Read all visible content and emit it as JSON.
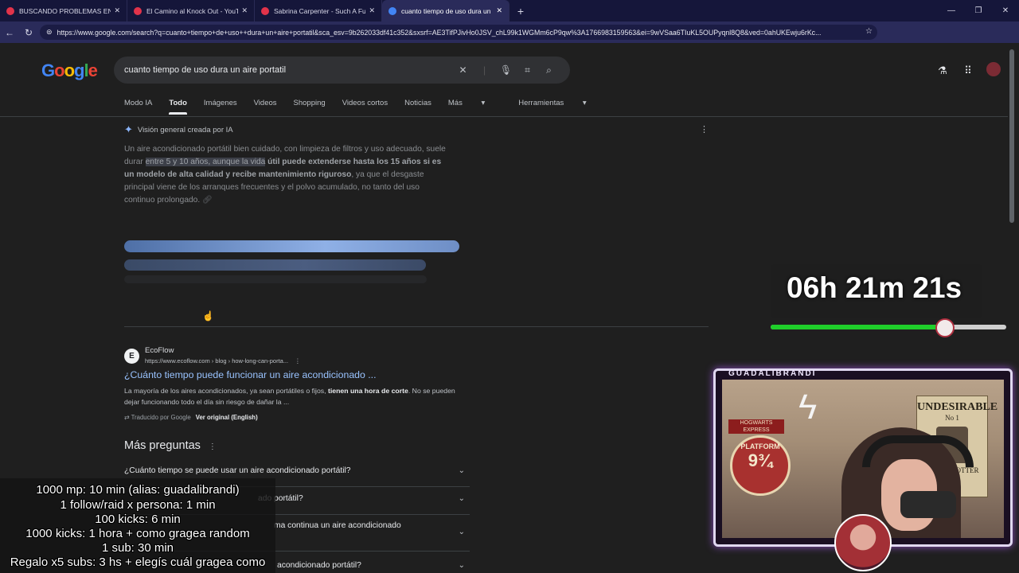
{
  "browser": {
    "tabs": [
      {
        "title": "BUSCANDO PROBLEMAS EN FLOR",
        "color": "#e2334a"
      },
      {
        "title": "El Camino al Knock Out - YouTube",
        "color": "#e2334a"
      },
      {
        "title": "Sabrina Carpenter - Such A Fu",
        "color": "#e2334a"
      },
      {
        "title": "cuanto tiempo de uso dura un aire",
        "color": "#4285f4"
      }
    ],
    "new_tab": "+",
    "url": "https://www.google.com/search?q=cuanto+tiempo+de+uso++dura+un+aire+portatil&sca_esv=9b262033df41c352&sxsrf=AE3TifPJivHo0JSV_chL99k1WGMm6cP9qw%3A1766983159563&ei=9wVSaa6TIuKL5OUPyqnl8Q8&ved=0ahUKEwju6rKc..."
  },
  "search": {
    "logo": "Google",
    "query": "cuanto tiempo de uso dura un aire portatil",
    "tabs": [
      "Modo IA",
      "Todo",
      "Imágenes",
      "Videos",
      "Shopping",
      "Videos cortos",
      "Noticias",
      "Más",
      "Herramientas"
    ]
  },
  "ai_overview": {
    "header": "Visión general creada por IA",
    "text_1": "Un aire acondicionado portátil bien cuidado, con limpieza de filtros y uso adecuado, suele durar ",
    "text_highlight": "entre 5 y 10 años, aunque la vida",
    "text_2": " útil puede extenderse hasta los 15 años si es un modelo de alta calidad y recibe mantenimiento riguroso",
    "text_3": ", ya que el desgaste principal viene de los arranques frecuentes y el polvo acumulado, no tanto del uso continuo prolongado."
  },
  "result": {
    "site": "EcoFlow",
    "url": "https://www.ecoflow.com › blog › how-long-can-porta...",
    "title": "¿Cuánto tiempo puede funcionar un aire acondicionado ...",
    "snippet_1": "La mayoría de los aires acondicionados, ya sean portátiles o fijos, ",
    "snippet_bold": "tienen una hora de corte",
    "snippet_2": ". No se pueden dejar funcionando todo el día sin riesgo de dañar la ...",
    "translated": "Traducido por Google",
    "original": "Ver original (English)"
  },
  "more_questions": {
    "title": "Más preguntas",
    "items": [
      "¿Cuánto tiempo se puede usar un aire acondicionado portátil?",
      "ado portátil?",
      "ma continua un aire acondicionado",
      "acondicionado portátil?"
    ]
  },
  "stream": {
    "timer": "06h 21m 21s",
    "timer_progress": 0.74,
    "cam_name": "GUADALIBRANDI",
    "poster_title": "UNDESIRABLE",
    "poster_no": "No 1",
    "poster_name": "HARRY POTTER",
    "platform": "PLATFORM",
    "platform_num": "9¾",
    "hogwarts": "HOGWARTS EXPRESS",
    "chat": [
      "1000 mp: 10 min (alias: guadalibrandi)",
      "1 follow/raid x persona: 1 min",
      "100 kicks: 6 min",
      "1000 kicks: 1 hora + como gragea random",
      "1 sub: 30 min",
      "Regalo x5 subs: 3 hs + elegís cuál gragea como"
    ]
  }
}
